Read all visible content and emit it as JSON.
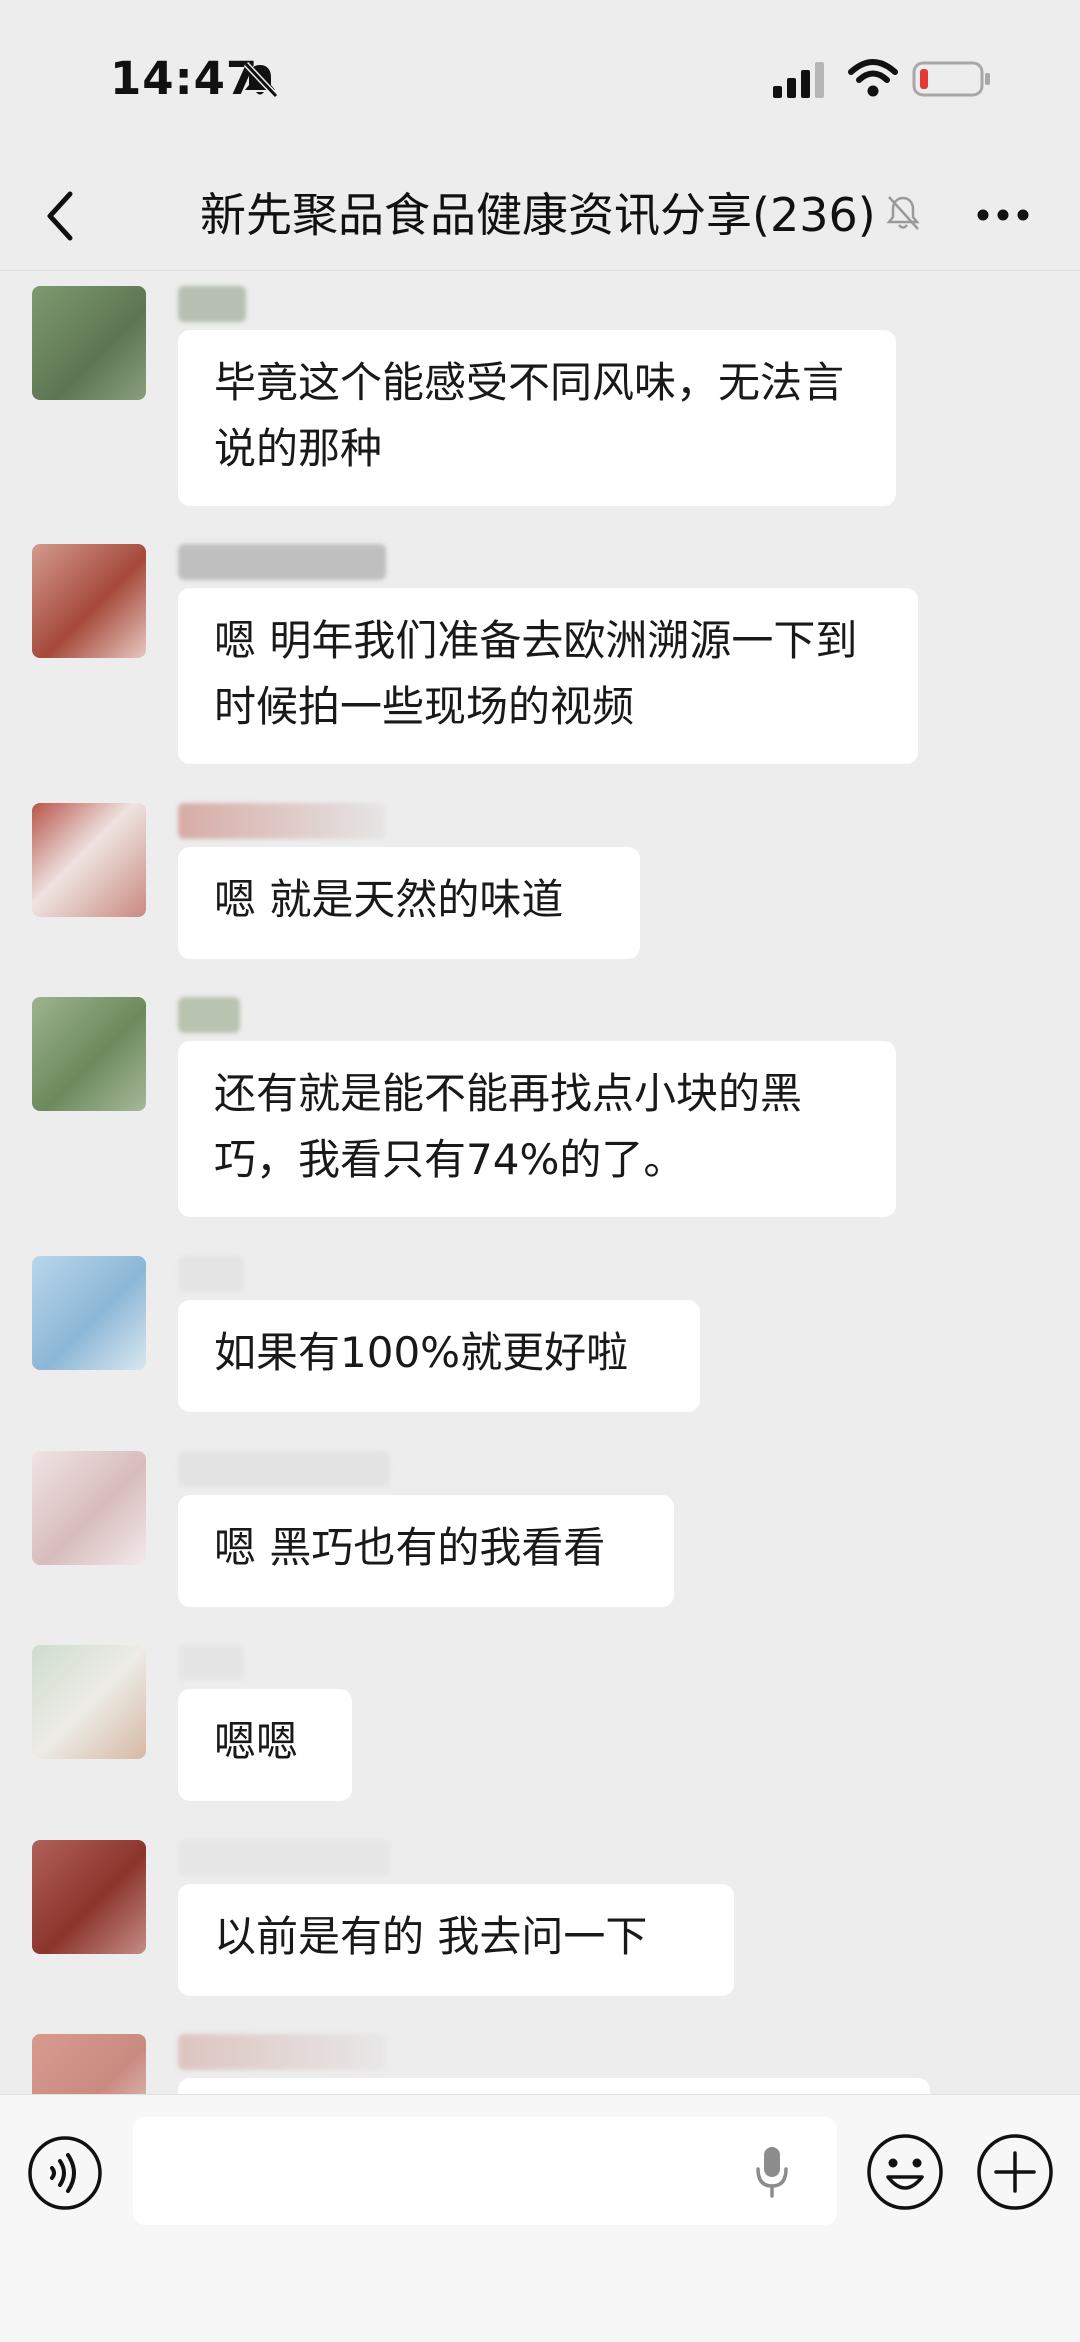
{
  "status_bar": {
    "time": "14:47",
    "icons": [
      "bell-slash-icon",
      "signal-icon",
      "wifi-icon",
      "battery-low-icon"
    ],
    "battery_color": "#e53935"
  },
  "header": {
    "title": "新先聚品食品健康资讯分享(236)",
    "icons": [
      "back-icon",
      "mute-icon",
      "more-icon"
    ]
  },
  "colors": {
    "background": "#ededed",
    "bubble": "#ffffff",
    "input_bar": "#f7f7f7"
  },
  "messages": [
    {
      "text": "毕竟这个能感受不同风味，无法言说的那种",
      "avatar_color": "#6f8a63"
    },
    {
      "text": "嗯 明年我们准备去欧洲溯源一下到时候拍一些现场的视频",
      "avatar_color": "#b96a5c"
    },
    {
      "text": "嗯 就是天然的味道",
      "avatar_color": "#b1716a"
    },
    {
      "text": "还有就是能不能再找点小块的黑巧，我看只有74%的了。",
      "avatar_color": "#7f9b6c"
    },
    {
      "text": "如果有100%就更好啦",
      "avatar_color": "#9cc4e0"
    },
    {
      "text": "嗯 黑巧也有的我看看",
      "avatar_color": "#e2cfd0"
    },
    {
      "text": "嗯嗯",
      "avatar_color": "#cfd6cf"
    },
    {
      "text": "以前是有的 我去问一下",
      "avatar_color": "#9e4a42"
    },
    {
      "text": "",
      "avatar_color": "#c98a80"
    }
  ],
  "input_bar": {
    "placeholder": "",
    "icons": [
      "voice-icon",
      "microphone-icon",
      "emoji-icon",
      "plus-icon"
    ]
  }
}
